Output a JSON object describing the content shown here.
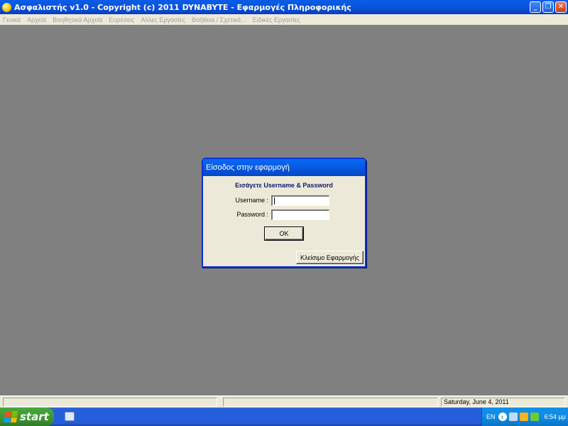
{
  "window": {
    "title": "Ασφαλιστής v1.0   -   Copyright (c) 2011 DYNABYTE - Εφαρμογές Πληροφορικής",
    "minimize": "_",
    "restore": "❐",
    "close": "✕"
  },
  "menu": [
    {
      "label": "Γενικά"
    },
    {
      "label": "Αρχεία"
    },
    {
      "label": "Βοηθητικά Αρχεία"
    },
    {
      "label": "Ευρέσεις"
    },
    {
      "label": "Αλλες Εργασίες"
    },
    {
      "label": "Βοήθεια / Σχετικά..."
    },
    {
      "label": "Ειδικές Εργασίες"
    }
  ],
  "dialog": {
    "title": "Είσοδος στην εφαρμογή",
    "header": "Εισάγετε Username & Password",
    "username_label": "Username :",
    "username_value": "",
    "password_label": "Password :",
    "password_value": "",
    "ok_label": "OK",
    "close_app_label": "Κλείσιμο Εφαρμογής"
  },
  "statusbar": {
    "panel1": "",
    "panel2": "",
    "date": "Saturday, June  4, 2011"
  },
  "taskbar": {
    "start_label": "start",
    "language": "EN",
    "time": "6:54 μμ"
  }
}
